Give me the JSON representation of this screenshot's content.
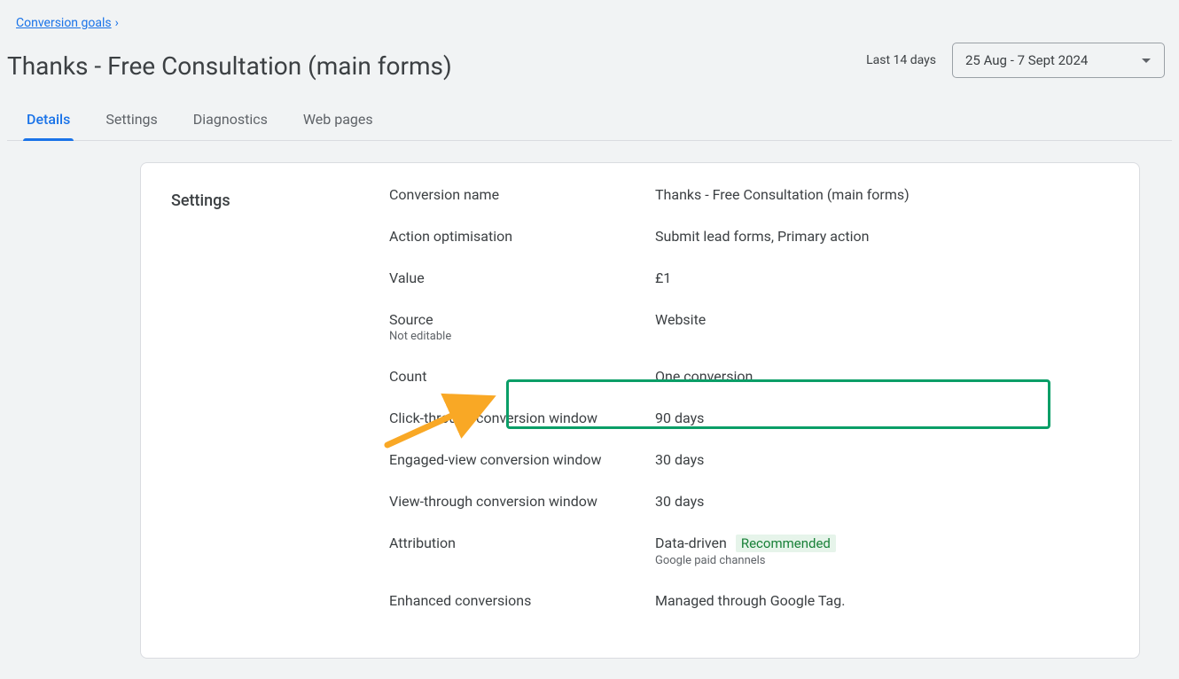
{
  "breadcrumb": {
    "back_label": "Conversion goals"
  },
  "header": {
    "title": "Thanks - Free Consultation (main forms)",
    "date_range_label": "Last 14 days",
    "date_range_value": "25 Aug - 7 Sept 2024"
  },
  "tabs": [
    {
      "label": "Details",
      "active": true
    },
    {
      "label": "Settings",
      "active": false
    },
    {
      "label": "Diagnostics",
      "active": false
    },
    {
      "label": "Web pages",
      "active": false
    }
  ],
  "card": {
    "section_title": "Settings",
    "rows": {
      "conversion_name": {
        "label": "Conversion name",
        "value": "Thanks - Free Consultation (main forms)"
      },
      "action_opt": {
        "label": "Action optimisation",
        "value": "Submit lead forms, Primary action"
      },
      "value": {
        "label": "Value",
        "value": "£1"
      },
      "source": {
        "label": "Source",
        "sublabel": "Not editable",
        "value": "Website"
      },
      "count": {
        "label": "Count",
        "value": "One conversion"
      },
      "ctc_window": {
        "label": "Click-through conversion window",
        "value": "90 days"
      },
      "ev_window": {
        "label": "Engaged-view conversion window",
        "value": "30 days"
      },
      "vt_window": {
        "label": "View-through conversion window",
        "value": "30 days"
      },
      "attribution": {
        "label": "Attribution",
        "value": "Data-driven",
        "badge": "Recommended",
        "subvalue": "Google paid channels"
      },
      "enhanced": {
        "label": "Enhanced conversions",
        "value": "Managed through Google Tag."
      }
    }
  }
}
